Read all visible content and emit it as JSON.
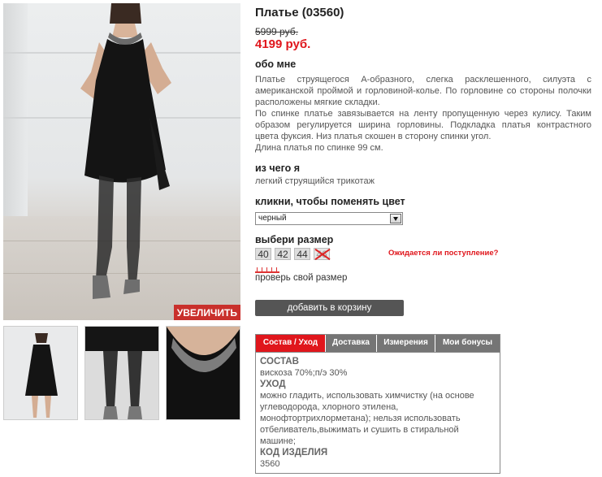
{
  "product": {
    "title": "Платье (03560)",
    "old_price": "5999 руб.",
    "new_price": "4199 руб."
  },
  "photo": {
    "zoom_label": "УВЕЛИЧИТЬ"
  },
  "about": {
    "heading": "обо мне",
    "paragraph1": "Платье струящегося А-образного, слегка расклешенного, силуэта с американской проймой и горловиной-колье. По горловине со стороны полочки расположены мягкие складки.",
    "paragraph2": "По спинке платье завязывается на ленту пропущенную через кулису. Таким образом регулируется ширина горловины. Подкладка платья контрастного цвета фуксия. Низ платья скошен в сторону спинки угол.",
    "paragraph3": "Длина платья по спинке 99 см."
  },
  "material": {
    "heading": "из чего я",
    "text": "легкий струящийся трикотаж"
  },
  "color": {
    "heading": "кликни, чтобы поменять цвет",
    "selected": "черный"
  },
  "size": {
    "heading": "выбери размер",
    "options": [
      "40",
      "42",
      "44",
      "46"
    ],
    "expected_link": "Ожидается ли поступление?",
    "check_label": "проверь свой размер"
  },
  "cart": {
    "button_label": "добавить в корзину"
  },
  "tabs": {
    "items": [
      "Состав / Уход",
      "Доставка",
      "Измерения",
      "Мои бонусы"
    ],
    "content": {
      "composition_h": "СОСТАВ",
      "composition": "вискоза 70%;п/э 30%",
      "care_h": "УХОД",
      "care": "можно гладить, использовать химчистку (на основе углеводорода, хлорного этилена, монофтортрихлорметана); нельзя использовать отбеливатель,выжимать и сушить в стиральной машине;",
      "code_h": "КОД ИЗДЕЛИЯ",
      "code": "3560"
    }
  },
  "colors": {
    "accent_red": "#e0161c",
    "button_gray": "#555555",
    "tab_gray": "#757575"
  }
}
